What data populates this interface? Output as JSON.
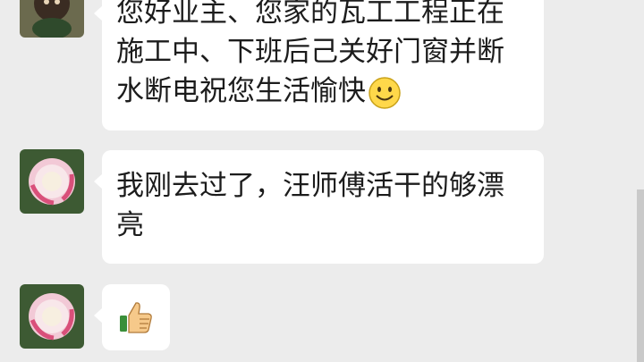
{
  "messages": [
    {
      "lines": [
        "您好业主、您家的瓦工工程正在",
        "施工中、下班后己关好门窗并断",
        "水断电祝您生活愉快"
      ],
      "emoji": "smiling-face-icon"
    },
    {
      "lines": [
        "我刚去过了，汪师傅活干的够漂",
        "亮"
      ]
    },
    {
      "emoji": "thumbs-up-icon"
    }
  ],
  "avatars": [
    "avatar-contact-icon",
    "avatar-rose-icon",
    "avatar-rose-icon"
  ],
  "colors": {
    "background": "#ececec",
    "bubble": "#ffffff",
    "text": "#1c1c1c"
  }
}
